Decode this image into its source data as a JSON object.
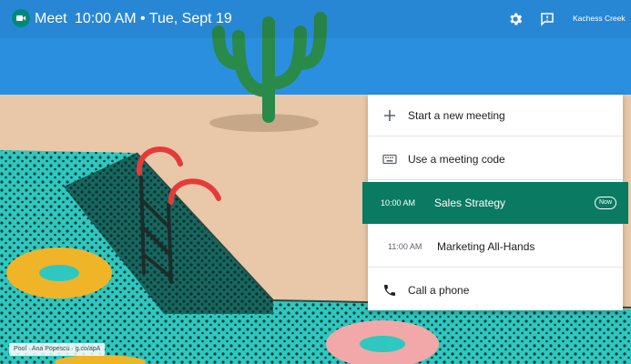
{
  "header": {
    "app_name": "Meet",
    "datetime": "10:00 AM • Tue, Sept 19",
    "device_name": "Kachess Creek",
    "icons": [
      "meet-logo",
      "settings-icon",
      "feedback-icon"
    ]
  },
  "menu": {
    "new_meeting": "Start a new meeting",
    "meeting_code": "Use a meeting code",
    "meetings": [
      {
        "time": "10:00 AM",
        "title": "Sales Strategy",
        "badge": "Now"
      },
      {
        "time": "11:00 AM",
        "title": "Marketing All-Hands"
      }
    ],
    "call_phone": "Call a phone"
  },
  "background": {
    "credit": "Pool · Ana Popescu · g.co/apA"
  },
  "colors": {
    "active_row": "#0b7a62",
    "sky": "#2b8fe0",
    "deck": "#e8c8a8",
    "pool": "#2ec8c0"
  }
}
